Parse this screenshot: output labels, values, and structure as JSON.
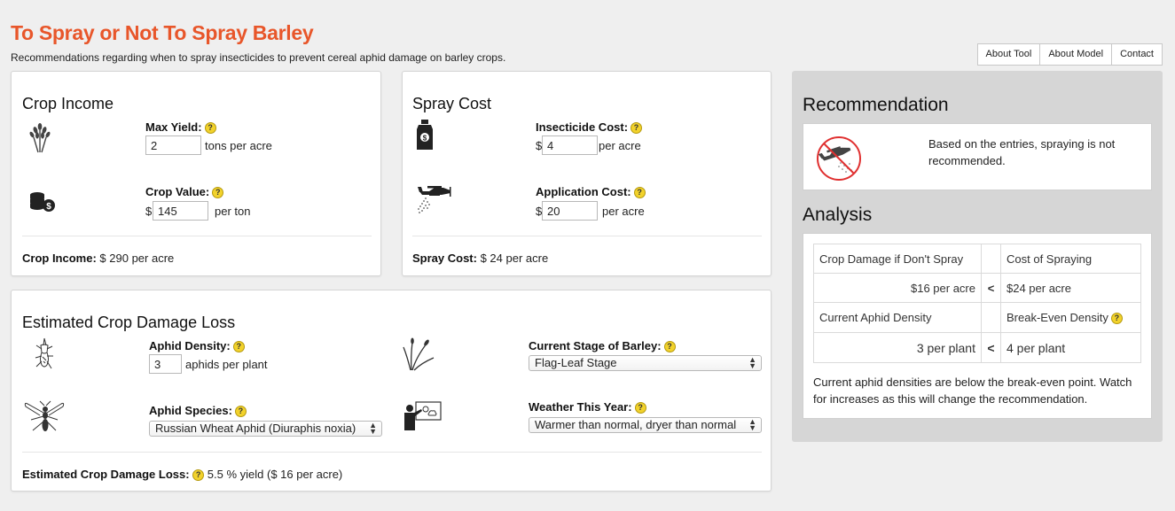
{
  "header": {
    "title": "To Spray or Not To Spray Barley",
    "subtitle": "Recommendations regarding when to spray insecticides to prevent cereal aphid damage on barley crops."
  },
  "nav": {
    "about_tool": "About Tool",
    "about_model": "About Model",
    "contact": "Contact"
  },
  "help_glyph": "?",
  "crop_income": {
    "title": "Crop Income",
    "max_yield_label": "Max Yield:",
    "max_yield_value": "2",
    "max_yield_unit": "tons per acre",
    "crop_value_label": "Crop Value:",
    "currency": "$",
    "crop_value_value": "145",
    "crop_value_unit": "per ton",
    "summary_label": "Crop Income:",
    "summary_value": "$ 290 per acre"
  },
  "spray_cost": {
    "title": "Spray Cost",
    "insecticide_label": "Insecticide Cost:",
    "currency": "$",
    "insecticide_value": "4",
    "insecticide_unit": "per acre",
    "application_label": "Application Cost:",
    "application_value": "20",
    "application_unit": "per acre",
    "summary_label": "Spray Cost:",
    "summary_value": "$ 24 per acre"
  },
  "damage": {
    "title": "Estimated Crop Damage Loss",
    "aphid_density_label": "Aphid Density:",
    "aphid_density_value": "3",
    "aphid_density_unit": "aphids per plant",
    "species_label": "Aphid Species:",
    "species_selected": "Russian Wheat Aphid (Diuraphis noxia)",
    "stage_label": "Current Stage of Barley:",
    "stage_selected": "Flag-Leaf Stage",
    "weather_label": "Weather This Year:",
    "weather_selected": "Warmer than normal, dryer than normal",
    "summary_label": "Estimated Crop Damage Loss:",
    "summary_value": "5.5 % yield ($ 16 per acre)"
  },
  "recommendation": {
    "title": "Recommendation",
    "text": "Based on the entries, spraying is not recommended."
  },
  "analysis": {
    "title": "Analysis",
    "rows": [
      {
        "left": "Crop Damage if Don't Spray",
        "op": "",
        "right": "Cost of Spraying",
        "help": false
      },
      {
        "left": "$16 per acre",
        "op": "<",
        "right": "$24 per acre",
        "help": false
      },
      {
        "left": "Current Aphid Density",
        "op": "",
        "right": "Break-Even Density",
        "help": true
      },
      {
        "left": "3 per plant",
        "op": "<",
        "right": "4 per plant",
        "help": false
      }
    ],
    "note": "Current aphid densities are below the break-even point. Watch for increases as this will change the recommendation."
  },
  "icons": {
    "grain": "wheat-icon",
    "coins": "coins-dollar-icon",
    "jug": "insecticide-jug-icon",
    "plane": "crop-duster-plane-icon",
    "aphid": "aphid-icon",
    "wasp": "wasp-insect-icon",
    "sprout": "barley-sprout-icon",
    "weather": "weather-presenter-icon",
    "noplane": "no-spraying-icon"
  },
  "colors": {
    "title": "#e8562a",
    "help_badge": "#f2d22b",
    "rec_panel": "#d6d6d6"
  }
}
